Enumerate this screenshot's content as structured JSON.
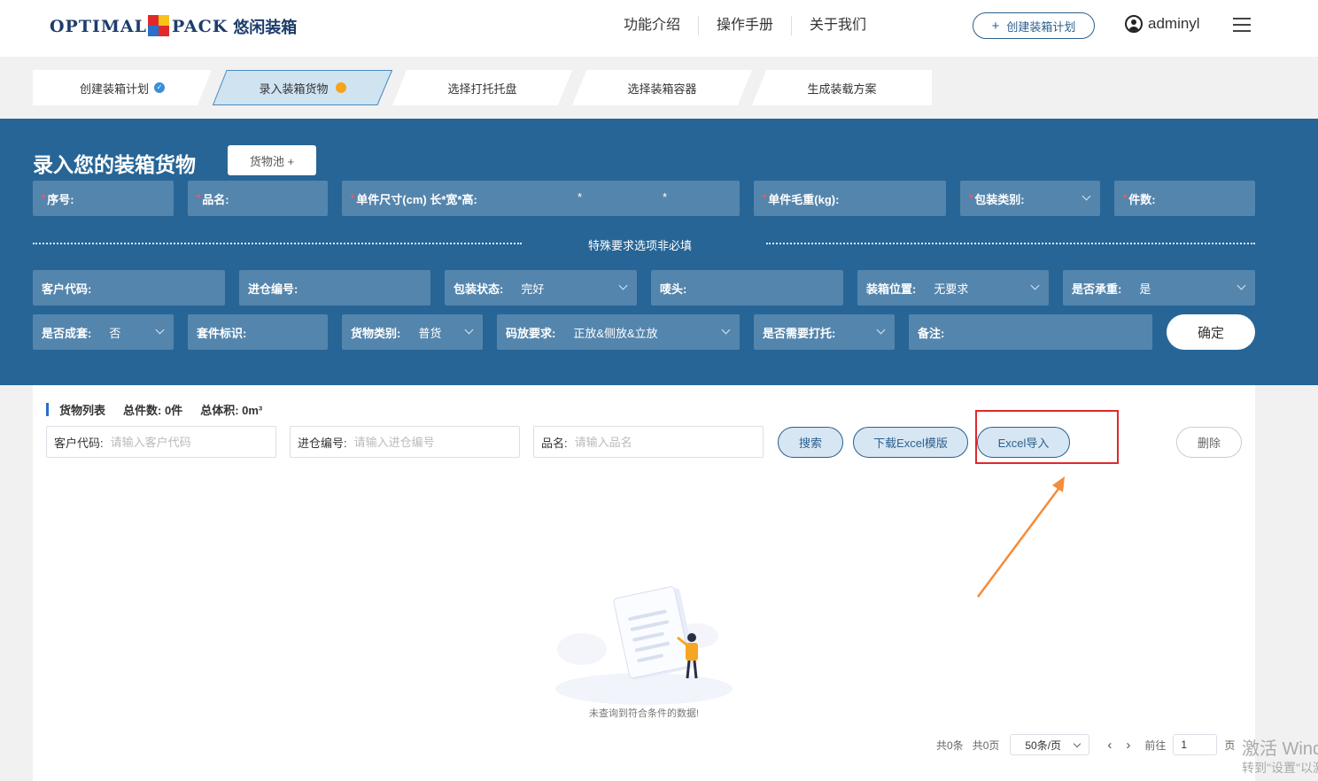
{
  "header": {
    "logo_text_left": "OPTIMAL",
    "logo_text_right": "PACK",
    "logo_cn": "悠闲装箱",
    "nav": [
      "功能介绍",
      "操作手册",
      "关于我们"
    ],
    "create_button": "创建装箱计划",
    "username": "adminyl"
  },
  "steps": [
    {
      "label": "创建装箱计划",
      "status": "done"
    },
    {
      "label": "录入装箱货物",
      "status": "active"
    },
    {
      "label": "选择打托托盘",
      "status": "todo"
    },
    {
      "label": "选择装箱容器",
      "status": "todo"
    },
    {
      "label": "生成装载方案",
      "status": "todo"
    }
  ],
  "form": {
    "title": "录入您的装箱货物",
    "pool_button": "货物池 +",
    "required_fields": {
      "serial": "序号:",
      "name": "品名:",
      "size": "单件尺寸(cm) 长*宽*高:",
      "size_sep": "*",
      "weight": "单件毛重(kg):",
      "package_type": "包装类别:",
      "quantity": "件数:"
    },
    "optional_divider": "特殊要求选项非必填",
    "row2": {
      "customer_code": "客户代码:",
      "warehouse_no": "进仓编号:",
      "package_status_label": "包装状态:",
      "package_status_value": "完好",
      "mark": "唛头:",
      "position_label": "装箱位置:",
      "position_value": "无要求",
      "bearing_label": "是否承重:",
      "bearing_value": "是"
    },
    "row3": {
      "set_label": "是否成套:",
      "set_value": "否",
      "set_mark": "套件标识:",
      "cargo_type_label": "货物类别:",
      "cargo_type_value": "普货",
      "stack_label": "码放要求:",
      "stack_value": "正放&侧放&立放",
      "pallet_label": "是否需要打托:",
      "remark": "备注:"
    },
    "confirm_button": "确定"
  },
  "list": {
    "title": "货物列表",
    "total_count": "总件数: 0件",
    "total_volume": "总体积: 0m³",
    "search": {
      "customer_label": "客户代码:",
      "customer_placeholder": "请输入客户代码",
      "warehouse_label": "进仓编号:",
      "warehouse_placeholder": "请输入进仓编号",
      "name_label": "品名:",
      "name_placeholder": "请输入品名"
    },
    "buttons": {
      "search": "搜索",
      "download": "下载Excel模版",
      "import": "Excel导入",
      "delete": "删除"
    },
    "empty_text": "未查询到符合条件的数据!",
    "pager": {
      "total_items": "共0条",
      "total_pages": "共0页",
      "page_size": "50条/页",
      "goto": "前往",
      "page": "1",
      "page_unit": "页"
    }
  },
  "watermark": {
    "line1": "激活 Windows",
    "line2": "转到\"设置\"以激活 Windows。"
  },
  "colors": {
    "panel_blue": "#276596",
    "field_blue": "#5485ad",
    "accent": "#2c5f8e",
    "highlight_red": "#e0282d",
    "arrow_orange": "#f58c3a"
  }
}
